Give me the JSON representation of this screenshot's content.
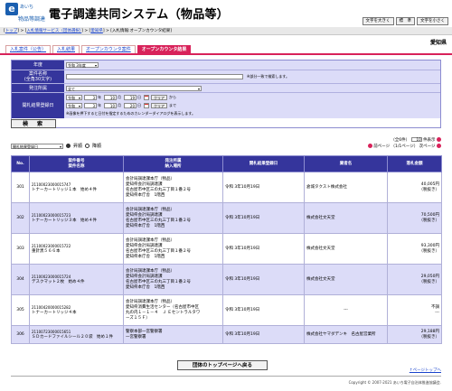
{
  "header": {
    "logo_mark": "e",
    "logo_top": "あいち",
    "logo_bottom": "物品等調達",
    "title": "電子調達共同システム（物品等）",
    "font_buttons": [
      "文字を大きく",
      "標　準",
      "文字を小さく"
    ]
  },
  "breadcrumb": {
    "items": [
      "トップ",
      "入札情報サービス（団体選択）",
      "愛知県",
      "入札情報:オープンカウンタ結果"
    ],
    "separator": " > "
  },
  "prefecture": "愛知県",
  "tabs": [
    {
      "label": "入札案件（公告）",
      "active": false
    },
    {
      "label": "入札結果",
      "active": false
    },
    {
      "label": "オープンカウンタ案件",
      "active": false
    },
    {
      "label": "オープンカウンタ結果",
      "active": true
    }
  ],
  "search": {
    "year_label": "年度",
    "year_value": "令和 3年度",
    "case_name_label": "案件名称",
    "case_name_sub": "(全角30文字)",
    "case_name_value": "",
    "case_name_note": "※部分一致で検索します。",
    "org_label": "発注所属",
    "org_value": "全て",
    "date_label": "開札結果登録日",
    "from_era": "令和",
    "from_year": "3",
    "from_month": "10",
    "from_day": "19",
    "to_era": "令和",
    "to_year": "3",
    "to_month": "10",
    "to_day": "20",
    "unit_year": "年",
    "unit_month": "月",
    "unit_day": "日",
    "clear_label": "クリア",
    "from_suffix": "から",
    "to_suffix": "まで",
    "date_note": "※画像を押下すると日付を指定するためのカレンダーダイアログを表示します。",
    "search_button": "検　索"
  },
  "sort": {
    "select_value": "開札結果登録日",
    "options": [
      "昇順",
      "降順"
    ],
    "selected": "昇順"
  },
  "pager": {
    "summary_prefix": "（全6件）",
    "per_page": "10",
    "per_page_suffix": "件表示",
    "prev_label": "前ページ",
    "page_info": "（1/1ページ）",
    "next_label": "次ページ"
  },
  "table": {
    "headers": {
      "no": "No.",
      "case_no": "案件番号",
      "case_name": "案件名称",
      "org": "発注所属",
      "delivery": "納入場所",
      "date": "開札結果登録日",
      "vendor": "業者名",
      "amount": "落札金額"
    },
    "rows": [
      {
        "no": "301",
        "case_no": "21100023000015747",
        "case_name": "トナーカートリッジ１本　始め４件",
        "org": "会計局調達課本庁（物品）",
        "delivery": [
          "愛知県会計局調達課",
          "名古屋市中区三の丸三丁目１番２号",
          "愛知県本庁舎　1階西"
        ],
        "date": "令和 3年10月19日",
        "vendor": "倉城タクスト株式会社",
        "amount": "40,005円",
        "tax": "（税抜き）"
      },
      {
        "no": "302",
        "case_no": "21100023000015723",
        "case_name": "トナーカートリッジ３本　始め４件",
        "org": "会計局調達課本庁（物品）",
        "delivery": [
          "愛知県会計局調達課",
          "名古屋市中区三の丸三丁目１番２号",
          "愛知県本庁舎　1階西"
        ],
        "date": "令和 3年10月19日",
        "vendor": "株式会社文天堂",
        "amount": "70,500円",
        "tax": "（税抜き）"
      },
      {
        "no": "303",
        "case_no": "21100023000015722",
        "case_name": "重針黒５６６本",
        "org": "会計局調達課本庁（物品）",
        "delivery": [
          "愛知県会計局調達課",
          "名古屋市中区三の丸三丁目１番２号",
          "愛知県本庁舎　1階西"
        ],
        "date": "令和 3年10月19日",
        "vendor": "株式会社文天堂",
        "amount": "93,300円",
        "tax": "（税抜き）"
      },
      {
        "no": "304",
        "case_no": "21100023000015724",
        "case_name": "デスクマット２枚　始め４件",
        "org": "会計局調達課本庁（物品）",
        "delivery": [
          "愛知県会計局調達課",
          "名古屋市中区三の丸三丁目１番２号",
          "愛知県本庁舎　1階西"
        ],
        "date": "令和 3年10月19日",
        "vendor": "株式会社文天堂",
        "amount": "29,050円",
        "tax": "（税抜き）"
      },
      {
        "no": "305",
        "case_no": "21100420000015282",
        "case_name": "トナーカートリッジ４本",
        "org": "会計局調達課本庁（物品）",
        "delivery": [
          "愛知県消費生活センター（名古屋市中区",
          "丸の内１－１－４　Ｊ Ｅセントラルタワ",
          "ーズ１５Ｆ）"
        ],
        "date": "令和 3年10月19日",
        "vendor": "---",
        "amount": "不調",
        "tax": "---"
      },
      {
        "no": "306",
        "case_no": "21100723000015651",
        "case_name": "ＳＤカードファイルシール２０袋　始め１件",
        "org": "警察本部一宮警察署",
        "delivery": [
          "一宮警察署"
        ],
        "date": "令和 3年10月19日",
        "vendor": "株式会社ヤマダデンキ　名古屋営業所",
        "amount": "29,188円",
        "tax": "（税抜き）"
      }
    ]
  },
  "footer": {
    "top_button": "団体のトップページへ戻る",
    "page_top": "↑ページトップへ",
    "copyright": "Copyright © 2007-2021 あいち電子自治体推進協議会."
  },
  "colors": {
    "accent": "#d8225a",
    "header_blue": "#35359c",
    "row_alt": "#dcdcf8"
  }
}
